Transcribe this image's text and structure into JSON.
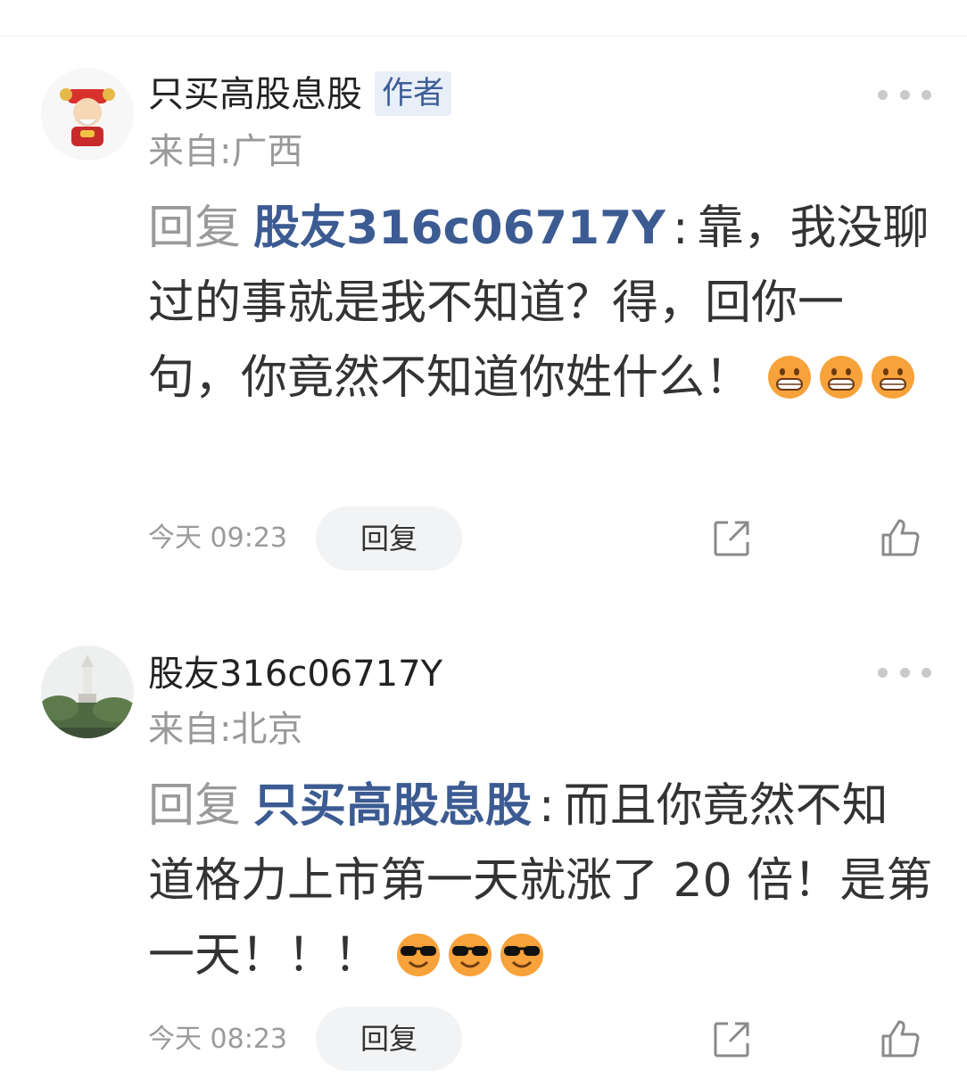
{
  "comments": [
    {
      "author": "只买高股息股",
      "badge": "作者",
      "location": "来自:广西",
      "reply_prefix": "回复",
      "mention": "股友316c06717Y",
      "colon": ":",
      "text": "靠，我没聊过的事就是我不知道？得，回你一句，你竟然不知道你姓什么！",
      "emoji": "grin-emoji",
      "emoji_count": 3,
      "time": "今天 09:23",
      "reply_label": "回复",
      "avatar_icon": "god-of-wealth-avatar"
    },
    {
      "author": "股友316c06717Y",
      "location": "来自:北京",
      "reply_prefix": "回复",
      "mention": "只买高股息股",
      "colon": ":",
      "text": "而且你竟然不知道格力上市第一天就涨了 20 倍！是第一天！！！",
      "emoji": "sunglasses-emoji",
      "emoji_count": 3,
      "time": "今天 08:23",
      "reply_label": "回复",
      "avatar_icon": "pagoda-photo-avatar"
    }
  ]
}
